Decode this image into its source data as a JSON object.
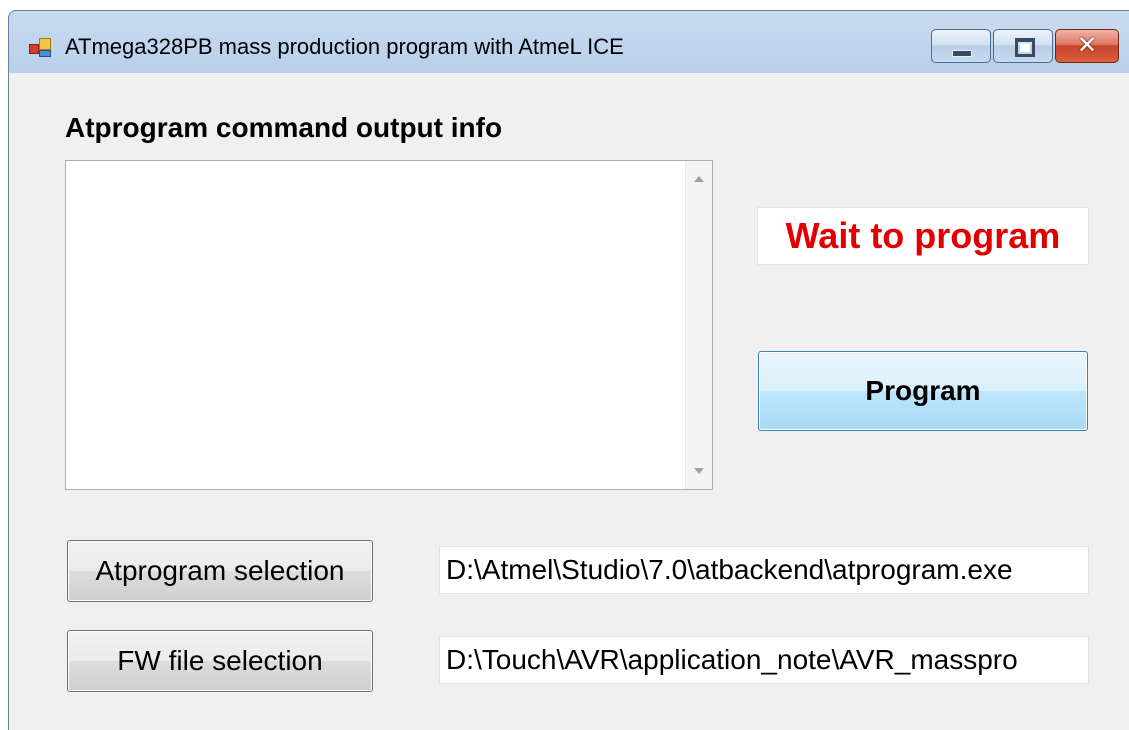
{
  "window": {
    "title": "ATmega328PB mass production program with AtmeL ICE",
    "icon": "app-form-icon",
    "controls": {
      "minimize": "minimize-icon",
      "maximize": "maximize-icon",
      "close_glyph": "✕"
    }
  },
  "main": {
    "heading": "Atprogram command output info",
    "output_text": "",
    "status_text": "Wait to program",
    "status_color": "#e00000",
    "program_label": "Program"
  },
  "selection": {
    "atprogram_label": "Atprogram selection",
    "atprogram_path": "D:\\Atmel\\Studio\\7.0\\atbackend\\atprogram.exe",
    "fw_label": "FW file selection",
    "fw_path": "D:\\Touch\\AVR\\application_note\\AVR_masspro"
  }
}
